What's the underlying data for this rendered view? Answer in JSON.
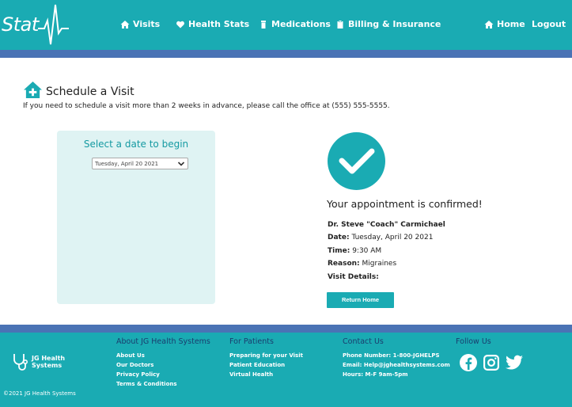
{
  "header": {
    "logo_text": "Stat",
    "nav": [
      {
        "label": "Visits",
        "icon": "home-icon"
      },
      {
        "label": "Health Stats",
        "icon": "heart-icon"
      },
      {
        "label": "Medications",
        "icon": "pill-bottle-icon"
      },
      {
        "label": "Billing & Insurance",
        "icon": "clipboard-icon"
      },
      {
        "label": "Home",
        "icon": "home-icon"
      },
      {
        "label": "Logout",
        "icon": ""
      }
    ]
  },
  "page": {
    "title": "Schedule a Visit",
    "subtitle": "If you need to schedule a visit more than 2 weeks in advance, please call the office at (555) 555-5555."
  },
  "date_picker": {
    "label": "Select a date to begin",
    "selected": "Tuesday, April 20 2021"
  },
  "confirmation": {
    "title": "Your appointment is confirmed!",
    "doctor": "Dr. Steve \"Coach\" Carmichael",
    "date_label": "Date:",
    "date_value": "Tuesday, April 20 2021",
    "time_label": "Time:",
    "time_value": "9:30 AM",
    "reason_label": "Reason:",
    "reason_value": "Migraines",
    "details_label": "Visit Details:",
    "button_label": "Return Home"
  },
  "footer": {
    "logo_line1": "JG Health",
    "logo_line2": "Systems",
    "copyright": "©2021 JG Health Systems",
    "columns": [
      {
        "heading": "About JG Health Systems",
        "links": [
          "About Us",
          "Our Doctors",
          "Privacy Policy",
          "Terms & Conditions"
        ]
      },
      {
        "heading": "For Patients",
        "links": [
          "Preparing for your Visit",
          "Patient Education",
          "Virtual Health"
        ]
      },
      {
        "heading": "Contact Us",
        "links": [
          "Phone Number: 1-800-JGHELPS",
          "Email: Help@jghealthsystems.com",
          "Hours: M-F 9am-5pm"
        ]
      },
      {
        "heading": "Follow Us",
        "links": []
      }
    ],
    "socials": [
      "facebook-icon",
      "instagram-icon",
      "twitter-icon"
    ]
  },
  "colors": {
    "teal": "#1aabb3",
    "blue_bar": "#4a73b5",
    "card_bg": "#dff3f3",
    "footer_heading": "#1a3c6e"
  }
}
